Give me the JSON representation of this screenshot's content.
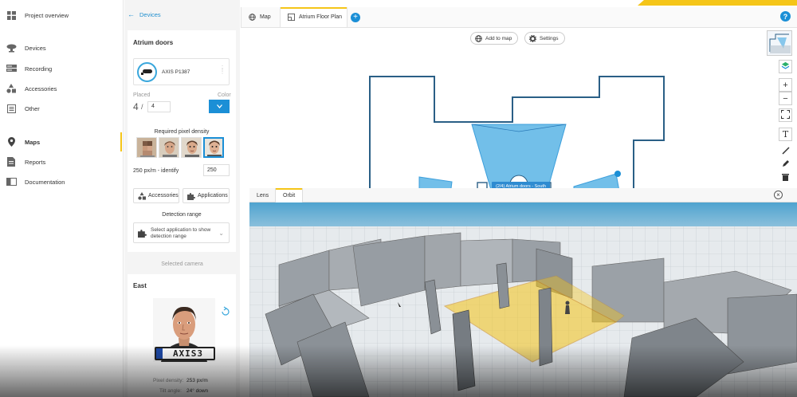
{
  "nav": {
    "items": [
      {
        "label": "Project overview",
        "icon": "grid-icon"
      },
      {
        "label": "Devices",
        "icon": "camera-icon"
      },
      {
        "label": "Recording",
        "icon": "recorder-icon"
      },
      {
        "label": "Accessories",
        "icon": "shapes-icon"
      },
      {
        "label": "Other",
        "icon": "list-icon"
      },
      {
        "label": "Maps",
        "icon": "map-pin-icon"
      },
      {
        "label": "Reports",
        "icon": "report-icon"
      },
      {
        "label": "Documentation",
        "icon": "book-icon"
      }
    ],
    "active": "Maps"
  },
  "panel": {
    "back_label": "Devices",
    "group_title": "Atrium doors",
    "camera_model": "AXIS P1387",
    "placed_label": "Placed",
    "color_label": "Color",
    "placed_count": "4",
    "placed_total": "4",
    "color_value": "#1b8fd6",
    "pixel_density_label": "Required pixel density",
    "density_text": "250 px/m - identify",
    "density_value": "250",
    "accessories_label": "Accessories",
    "applications_label": "Applications",
    "detection_range_label": "Detection range",
    "app_select_text": "Select application to show detection range",
    "selected_camera_label": "Selected camera",
    "selected_title": "East",
    "plate_text": "AXIS3",
    "pixel_density_row_label": "Pixel density:",
    "pixel_density_row_value": "253 px/m",
    "tilt_label": "Tilt angle:",
    "tilt_value": "24° down"
  },
  "tabs": {
    "map_label": "Map",
    "floor_plan_label": "Atrium Floor Plan",
    "active": "Atrium Floor Plan"
  },
  "map": {
    "add_to_map_label": "Add to map",
    "settings_label": "Settings",
    "tooltip": "(2/4) Atrium doors - South"
  },
  "view3d": {
    "lens_label": "Lens",
    "orbit_label": "Orbit",
    "active": "Orbit"
  },
  "colors": {
    "accent": "#1b8fd6",
    "highlight": "#f5c518",
    "coverage_fill": "#5ab4e6",
    "floor_outline": "#2a5f86"
  }
}
